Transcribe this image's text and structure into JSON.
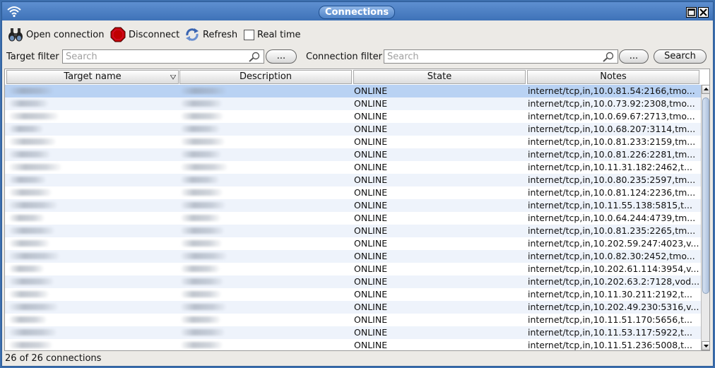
{
  "window": {
    "title": "Connections"
  },
  "toolbar": {
    "open_label": "Open connection",
    "disconnect_label": "Disconnect",
    "refresh_label": "Refresh",
    "realtime_label": "Real time"
  },
  "filters": {
    "target_label": "Target filter",
    "target_placeholder": "Search",
    "connection_label": "Connection filter",
    "connection_placeholder": "Search",
    "more_label": "...",
    "search_button": "Search"
  },
  "table": {
    "columns": [
      "Target name",
      "Description",
      "State",
      "Notes"
    ],
    "rows": [
      {
        "state": "ONLINE",
        "notes": "internet/tcp,in,10.0.81.54:2166,tmo..."
      },
      {
        "state": "ONLINE",
        "notes": "internet/tcp,in,10.0.73.92:2308,tmo..."
      },
      {
        "state": "ONLINE",
        "notes": "internet/tcp,in,10.0.69.67:2713,tmo..."
      },
      {
        "state": "ONLINE",
        "notes": "internet/tcp,in,10.0.68.207:3114,tm..."
      },
      {
        "state": "ONLINE",
        "notes": "internet/tcp,in,10.0.81.233:2159,tm..."
      },
      {
        "state": "ONLINE",
        "notes": "internet/tcp,in,10.0.81.226:2281,tm..."
      },
      {
        "state": "ONLINE",
        "notes": "internet/tcp,in,10.11.31.182:2462,t..."
      },
      {
        "state": "ONLINE",
        "notes": "internet/tcp,in,10.0.80.235:2597,tm..."
      },
      {
        "state": "ONLINE",
        "notes": "internet/tcp,in,10.0.81.124:2236,tm..."
      },
      {
        "state": "ONLINE",
        "notes": "internet/tcp,in,10.11.55.138:5815,t..."
      },
      {
        "state": "ONLINE",
        "notes": "internet/tcp,in,10.0.64.244:4739,tm..."
      },
      {
        "state": "ONLINE",
        "notes": "internet/tcp,in,10.0.81.235:2265,tm..."
      },
      {
        "state": "ONLINE",
        "notes": "internet/tcp,in,10.202.59.247:4023,v..."
      },
      {
        "state": "ONLINE",
        "notes": "internet/tcp,in,10.0.82.30:2452,tmo..."
      },
      {
        "state": "ONLINE",
        "notes": "internet/tcp,in,10.202.61.114:3954,v..."
      },
      {
        "state": "ONLINE",
        "notes": "internet/tcp,in,10.202.63.2:7128,vod..."
      },
      {
        "state": "ONLINE",
        "notes": "internet/tcp,in,10.11.30.211:2192,t..."
      },
      {
        "state": "ONLINE",
        "notes": "internet/tcp,in,10.202.49.230:5316,v..."
      },
      {
        "state": "ONLINE",
        "notes": "internet/tcp,in,10.11.51.170:5656,t..."
      },
      {
        "state": "ONLINE",
        "notes": "internet/tcp,in,10.11.53.117:5922,t..."
      },
      {
        "state": "ONLINE",
        "notes": "internet/tcp,in,10.11.51.236:5008,t..."
      }
    ]
  },
  "status": {
    "text": "26 of 26 connections"
  },
  "colors": {
    "title_bar": "#3e72b8",
    "selection": "#b9d2f3",
    "window_bg": "#eceae6"
  }
}
